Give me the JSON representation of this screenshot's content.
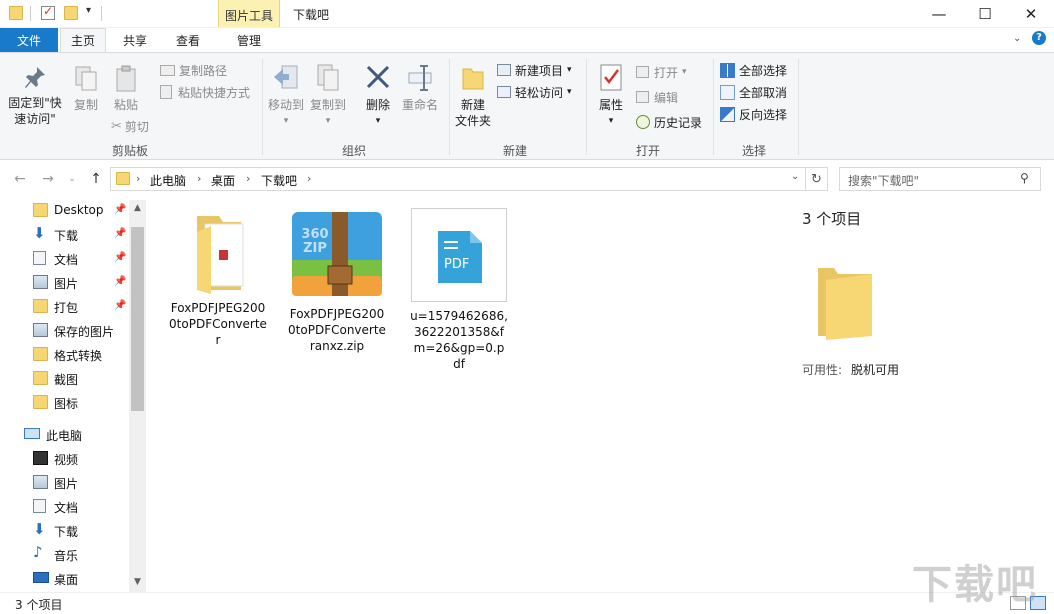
{
  "window": {
    "context_tab_header": "图片工具",
    "title": "下载吧",
    "controls": [
      "—",
      "☐",
      "✕"
    ]
  },
  "tabs": {
    "file": "文件",
    "home": "主页",
    "share": "共享",
    "view": "查看",
    "manage": "管理"
  },
  "ribbon": {
    "clipboard": {
      "pin_label_1": "固定到\"快",
      "pin_label_2": "速访问\"",
      "copy": "复制",
      "paste": "粘贴",
      "copy_path": "复制路径",
      "paste_shortcut": "粘贴快捷方式",
      "cut": "剪切",
      "group": "剪贴板"
    },
    "organize": {
      "move_to": "移动到",
      "copy_to": "复制到",
      "delete": "删除",
      "rename": "重命名",
      "group": "组织"
    },
    "new": {
      "new_folder_1": "新建",
      "new_folder_2": "文件夹",
      "new_item": "新建项目",
      "easy_access": "轻松访问",
      "group": "新建"
    },
    "open": {
      "properties": "属性",
      "open": "打开",
      "edit": "编辑",
      "history": "历史记录",
      "group": "打开"
    },
    "select": {
      "select_all": "全部选择",
      "select_none": "全部取消",
      "invert": "反向选择",
      "group": "选择"
    }
  },
  "address": {
    "crumbs": [
      "此电脑",
      "桌面",
      "下载吧"
    ],
    "search_placeholder": "搜索\"下载吧\""
  },
  "nav": {
    "quick_access": [
      {
        "label": "Desktop",
        "icon": "folder-icon",
        "pinned": true
      },
      {
        "label": "下载",
        "icon": "download-icon",
        "pinned": true
      },
      {
        "label": "文档",
        "icon": "document-icon",
        "pinned": true
      },
      {
        "label": "图片",
        "icon": "picture-icon",
        "pinned": true
      },
      {
        "label": "打包",
        "icon": "folder-icon",
        "pinned": true
      },
      {
        "label": "保存的图片",
        "icon": "picture-icon",
        "pinned": false
      },
      {
        "label": "格式转换",
        "icon": "folder-icon",
        "pinned": false
      },
      {
        "label": "截图",
        "icon": "folder-icon",
        "pinned": false
      },
      {
        "label": "图标",
        "icon": "folder-icon",
        "pinned": false
      }
    ],
    "this_pc": "此电脑",
    "pc_items": [
      {
        "label": "视频",
        "icon": "video-icon"
      },
      {
        "label": "图片",
        "icon": "picture-icon"
      },
      {
        "label": "文档",
        "icon": "document-icon"
      },
      {
        "label": "下载",
        "icon": "download-icon"
      },
      {
        "label": "音乐",
        "icon": "music-icon"
      },
      {
        "label": "桌面",
        "icon": "desktop-icon"
      }
    ]
  },
  "files": [
    {
      "name": "FoxPDFJPEG2000toPDFConverter",
      "type": "folder"
    },
    {
      "name": "FoxPDFJPEG2000toPDFConverteranxz.zip",
      "type": "zip"
    },
    {
      "name": "u=1579462686,3622201358&fm=26&gp=0.pdf",
      "type": "pdf",
      "badge": "PDF"
    }
  ],
  "details": {
    "count": "3 个项目",
    "availability_label": "可用性:",
    "availability_value": "脱机可用"
  },
  "zip_badge": "360 ZIP",
  "status": {
    "count": "3 个项目"
  },
  "watermark": "下载吧",
  "colors": {
    "accent": "#1979ca",
    "context_tab": "#fbf1b3",
    "folder": "#f7d774"
  }
}
